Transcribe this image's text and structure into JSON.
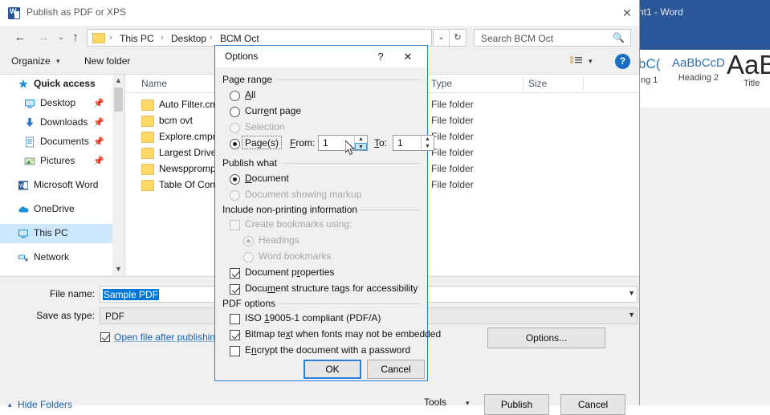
{
  "word_window": {
    "title": "nt1 - Word",
    "styles": [
      {
        "preview": "bC(",
        "name": "ng 1"
      },
      {
        "preview": "AaBbCcD",
        "name": "Heading 2"
      },
      {
        "preview": "AaB",
        "name": "Title"
      }
    ]
  },
  "publish_dialog": {
    "title": "Publish as PDF or XPS",
    "icon": "word-icon",
    "close_label": "✕",
    "nav": {
      "back_icon": "←",
      "forward_icon": "→",
      "recent_icon": "⌄",
      "up_icon": "↑",
      "breadcrumbs": [
        "This PC",
        "Desktop",
        "BCM Oct"
      ],
      "separator": "›",
      "dropdown_icon": "⌄",
      "refresh_icon": "↻"
    },
    "search": {
      "placeholder": "Search BCM Oct",
      "icon": "search-icon"
    },
    "toolbar": {
      "organize_label": "Organize",
      "organize_caret": "▾",
      "new_folder_label": "New folder",
      "view_caret": "▾",
      "help_label": "?"
    },
    "nav_pane": [
      {
        "label": "Quick access",
        "icon": "star-icon",
        "pinned": false,
        "selected": false
      },
      {
        "label": "Desktop",
        "icon": "monitor-icon",
        "pinned": true,
        "selected": false
      },
      {
        "label": "Downloads",
        "icon": "download-icon",
        "pinned": true,
        "selected": false
      },
      {
        "label": "Documents",
        "icon": "document-icon",
        "pinned": true,
        "selected": false
      },
      {
        "label": "Pictures",
        "icon": "picture-icon",
        "pinned": true,
        "selected": false
      },
      {
        "label": "Microsoft Word",
        "icon": "word-icon",
        "pinned": false,
        "selected": false
      },
      {
        "label": "OneDrive",
        "icon": "cloud-icon",
        "pinned": false,
        "selected": false
      },
      {
        "label": "This PC",
        "icon": "monitor-icon",
        "pinned": false,
        "selected": true
      },
      {
        "label": "Network",
        "icon": "network-icon",
        "pinned": false,
        "selected": false
      }
    ],
    "file_list": {
      "columns": [
        "Name",
        "Type",
        "Size"
      ],
      "rows": [
        {
          "name": "Auto Filter.cm",
          "type": "File folder",
          "size": ""
        },
        {
          "name": "bcm ovt",
          "type": "File folder",
          "size": ""
        },
        {
          "name": "Explore.cmpro",
          "type": "File folder",
          "size": ""
        },
        {
          "name": "Largest Drive F",
          "type": "File folder",
          "size": ""
        },
        {
          "name": "Newspprompt",
          "type": "File folder",
          "size": ""
        },
        {
          "name": "Table Of Conte",
          "type": "File folder",
          "size": ""
        }
      ]
    },
    "form": {
      "file_name_label": "File name:",
      "file_name_value": "Sample PDF",
      "save_as_type_label": "Save as type:",
      "save_as_type_value": "PDF",
      "open_after_publishing_label": "Open file after publishing",
      "open_after_publishing_checked": true,
      "options_button": "Options...",
      "hide_folders_label": "Hide Folders",
      "hide_folders_caret": "▴",
      "tools_label": "Tools",
      "tools_caret": "▾",
      "publish_button": "Publish",
      "cancel_button": "Cancel"
    }
  },
  "options_dialog": {
    "title": "Options",
    "help_label": "?",
    "close_label": "✕",
    "page_range": {
      "group_label": "Page range",
      "options": [
        {
          "label": "All",
          "selected": false,
          "disabled": false,
          "accel": "A"
        },
        {
          "label": "Current page",
          "selected": false,
          "disabled": false,
          "accel": "e"
        },
        {
          "label": "Selection",
          "selected": false,
          "disabled": true,
          "accel": ""
        },
        {
          "label": "Page(s)",
          "selected": true,
          "disabled": false,
          "accel": "g"
        }
      ],
      "from_label": "From:",
      "from_value": "1",
      "to_label": "To:",
      "to_value": "1",
      "spin_up": "▲",
      "spin_down": "▼"
    },
    "publish_what": {
      "group_label": "Publish what",
      "options": [
        {
          "label": "Document",
          "selected": true,
          "disabled": false
        },
        {
          "label": "Document showing markup",
          "selected": false,
          "disabled": true
        }
      ]
    },
    "non_printing": {
      "group_label": "Include non-printing information",
      "items": [
        {
          "type": "checkbox",
          "label": "Create bookmarks using:",
          "checked": false,
          "disabled": true
        },
        {
          "type": "radio",
          "label": "Headings",
          "checked": true,
          "disabled": true
        },
        {
          "type": "radio",
          "label": "Word bookmarks",
          "checked": false,
          "disabled": true
        },
        {
          "type": "checkbox",
          "label": "Document properties",
          "checked": true,
          "disabled": false
        },
        {
          "type": "checkbox",
          "label": "Document structure tags for accessibility",
          "checked": true,
          "disabled": false
        }
      ]
    },
    "pdf_options": {
      "group_label": "PDF options",
      "items": [
        {
          "label": "ISO 19005-1 compliant (PDF/A)",
          "checked": false,
          "disabled": false
        },
        {
          "label": "Bitmap text when fonts may not be embedded",
          "checked": true,
          "disabled": false
        },
        {
          "label": "Encrypt the document with a password",
          "checked": false,
          "disabled": false
        }
      ]
    },
    "ok_button": "OK",
    "cancel_button": "Cancel"
  },
  "colors": {
    "word_blue": "#2b579a",
    "accent_blue": "#2a7fd4",
    "selection_blue": "#0078d7",
    "link_blue": "#1961b0"
  }
}
